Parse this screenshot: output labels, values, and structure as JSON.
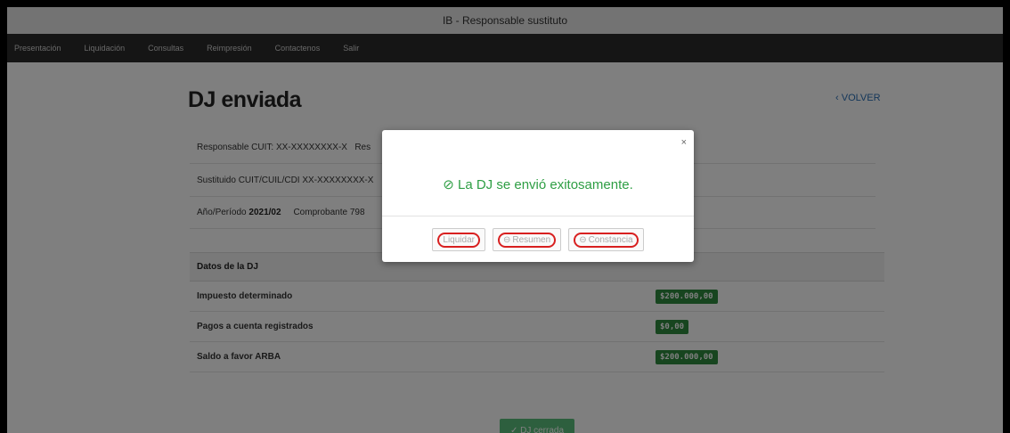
{
  "window": {
    "title": "IB - Responsable sustituto"
  },
  "nav": {
    "items": [
      "Presentación",
      "Liquidación",
      "Consultas",
      "Reimpresión",
      "Contactenos",
      "Salir"
    ]
  },
  "page": {
    "title": "DJ enviada",
    "back_label": "VOLVER"
  },
  "info": {
    "responsable_label": "Responsable CUIT:",
    "responsable_value": "XX-XXXXXXXX-X",
    "responsable_tail": "Res",
    "sustituido_label": "Sustituido CUIT/CUIL/CDI",
    "sustituido_value": "XX-XXXXXXXX-X",
    "periodo_label": "Año/Período",
    "periodo_value": "2021/02",
    "comprobante_label": "Comprobante",
    "comprobante_value": "798"
  },
  "table": {
    "header": "Datos de la DJ",
    "rows": [
      {
        "label": "Impuesto determinado",
        "value": "$200.000,00"
      },
      {
        "label": "Pagos a cuenta registrados",
        "value": "$0,00"
      },
      {
        "label": "Saldo a favor ARBA",
        "value": "$200.000,00"
      }
    ]
  },
  "footer": {
    "cerrada_label": "DJ cerrada"
  },
  "modal": {
    "message": "La DJ se envió exitosamente.",
    "close": "×",
    "buttons": {
      "liquidar": "Liquidar",
      "resumen": "Resumen",
      "constancia": "Constancia"
    }
  },
  "colors": {
    "success": "#2e9e44",
    "badge": "#2e8b3f",
    "link": "#2a6fb5",
    "highlight_oval": "#d82020"
  },
  "icons": {
    "check": "check-circle-icon",
    "chevron": "chevron-left-icon",
    "print": "print-icon"
  }
}
